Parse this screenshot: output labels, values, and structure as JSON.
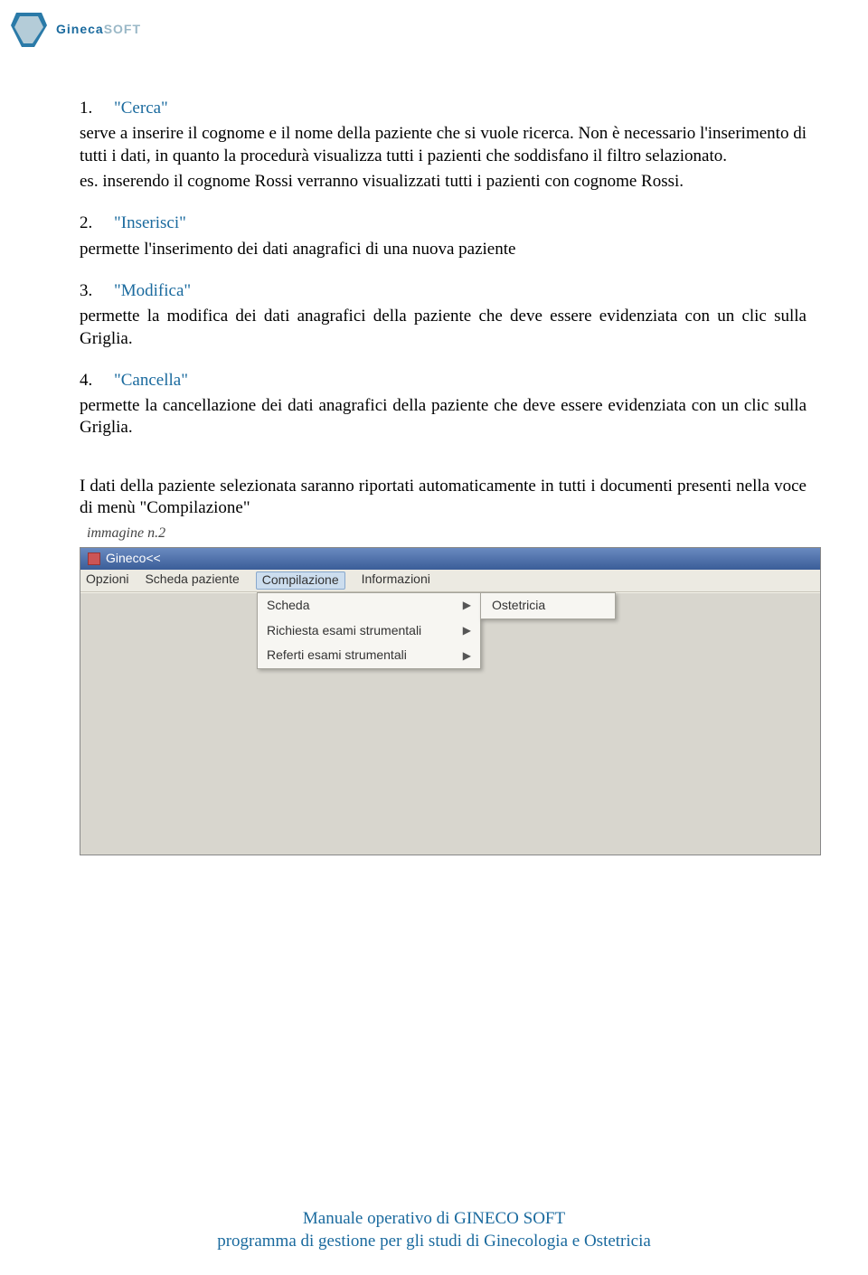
{
  "logo": {
    "brand1": "Gineca",
    "brand2": "SOFT"
  },
  "sections": {
    "cerca": {
      "num": "1.",
      "title": "\"Cerca\"",
      "p1": "serve a inserire il cognome e il nome della paziente che si vuole ricerca. Non è necessario l'inserimento di tutti i dati, in quanto la procedurà visualizza tutti i pazienti che soddisfano il filtro selazionato.",
      "p2": "es. inserendo il cognome Rossi verranno visualizzati tutti i pazienti con cognome Rossi."
    },
    "inserisci": {
      "num": "2.",
      "title": "\"Inserisci\"",
      "p1": "permette l'inserimento dei dati anagrafici di una nuova paziente"
    },
    "modifica": {
      "num": "3.",
      "title": "\"Modifica\"",
      "p1": "permette la modifica dei dati anagrafici della paziente che deve essere evidenziata con un clic sulla Griglia."
    },
    "cancella": {
      "num": "4.",
      "title": "\"Cancella\"",
      "p1": "permette la cancellazione dei dati anagrafici della paziente che deve essere evidenziata con un clic  sulla Griglia."
    }
  },
  "final": "I dati della paziente selezionata saranno riportati automaticamente in tutti i documenti  presenti nella voce di menù \"Compilazione\"",
  "caption": "immagine n.2",
  "app": {
    "title": "Gineco<<",
    "menu": [
      "Opzioni",
      "Scheda paziente",
      "Compilazione",
      "Informazioni"
    ],
    "dropdown": [
      "Scheda",
      "Richiesta esami strumentali",
      "Referti esami strumentali"
    ],
    "submenu": [
      "Ostetricia"
    ]
  },
  "footer": {
    "l1": "Manuale operativo di GINECO SOFT",
    "l2": "programma di gestione per gli studi di Ginecologia e Ostetricia"
  }
}
